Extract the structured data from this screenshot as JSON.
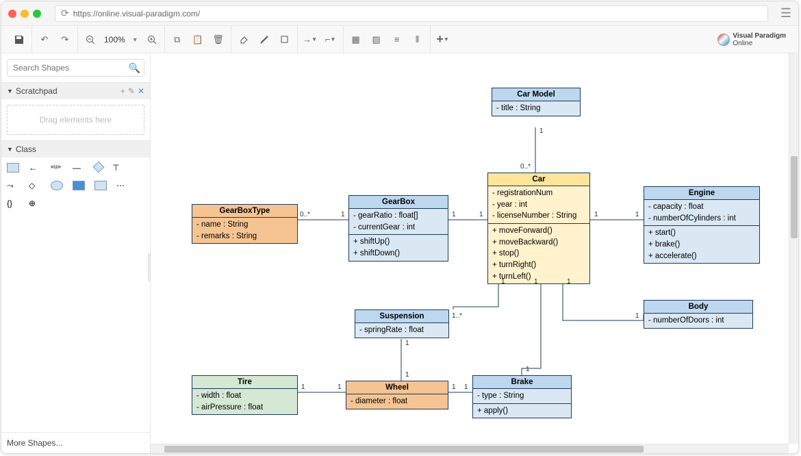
{
  "browser": {
    "url": "https://online.visual-paradigm.com/"
  },
  "toolbar": {
    "zoom": "100%",
    "brand_line1": "Visual Paradigm",
    "brand_line2": "Online"
  },
  "sidebar": {
    "search_placeholder": "Search Shapes",
    "scratchpad_label": "Scratchpad",
    "drag_hint": "Drag elements here",
    "class_label": "Class",
    "more_shapes": "More Shapes..."
  },
  "classes": {
    "carModel": {
      "name": "Car Model",
      "attrs": [
        "- title : String"
      ]
    },
    "gearBoxType": {
      "name": "GearBoxType",
      "attrs": [
        "- name : String",
        "- remarks : String"
      ]
    },
    "gearBox": {
      "name": "GearBox",
      "attrs": [
        "- gearRatio : float[]",
        "- currentGear : int"
      ],
      "ops": [
        "+ shiftUp()",
        "+ shiftDown()"
      ]
    },
    "car": {
      "name": "Car",
      "attrs": [
        "- registrationNum",
        "- year : int",
        "- licenseNumber : String"
      ],
      "ops": [
        "+ moveForward()",
        "+ moveBackward()",
        "+ stop()",
        "+ turnRight()",
        "+ turnLeft()"
      ]
    },
    "engine": {
      "name": "Engine",
      "attrs": [
        "- capacity : float",
        "- numberOfCylinders : int"
      ],
      "ops": [
        "+ start()",
        "+ brake()",
        "+ accelerate()"
      ]
    },
    "suspension": {
      "name": "Suspension",
      "attrs": [
        "- springRate : float"
      ]
    },
    "body": {
      "name": "Body",
      "attrs": [
        "- numberOfDoors : int"
      ]
    },
    "tire": {
      "name": "Tire",
      "attrs": [
        "- width : float",
        "- airPressure : float"
      ]
    },
    "wheel": {
      "name": "Wheel",
      "attrs": [
        "- diameter : float"
      ]
    },
    "brake": {
      "name": "Brake",
      "attrs": [
        "- type : String"
      ],
      "ops": [
        "+ apply()"
      ]
    }
  },
  "multiplicities": {
    "carModel_car_top": "1",
    "carModel_car_bottom": "0..*",
    "gearBoxType_gearBox_left": "0..*",
    "gearBoxType_gearBox_right": "1",
    "gearBox_car_left": "1",
    "gearBox_car_right": "1",
    "car_engine_left": "1",
    "car_engine_right": "1",
    "car_suspension_top": "1",
    "car_suspension_bottom": "1..*",
    "car_brake_top": "1",
    "car_brake_bottom": "1",
    "car_body_top": "1",
    "car_body_bottom": "1",
    "suspension_wheel_top": "1",
    "suspension_wheel_bottom": "1",
    "tire_wheel_left": "1",
    "tire_wheel_right": "1",
    "wheel_brake_left": "1",
    "wheel_brake_right": "1"
  }
}
